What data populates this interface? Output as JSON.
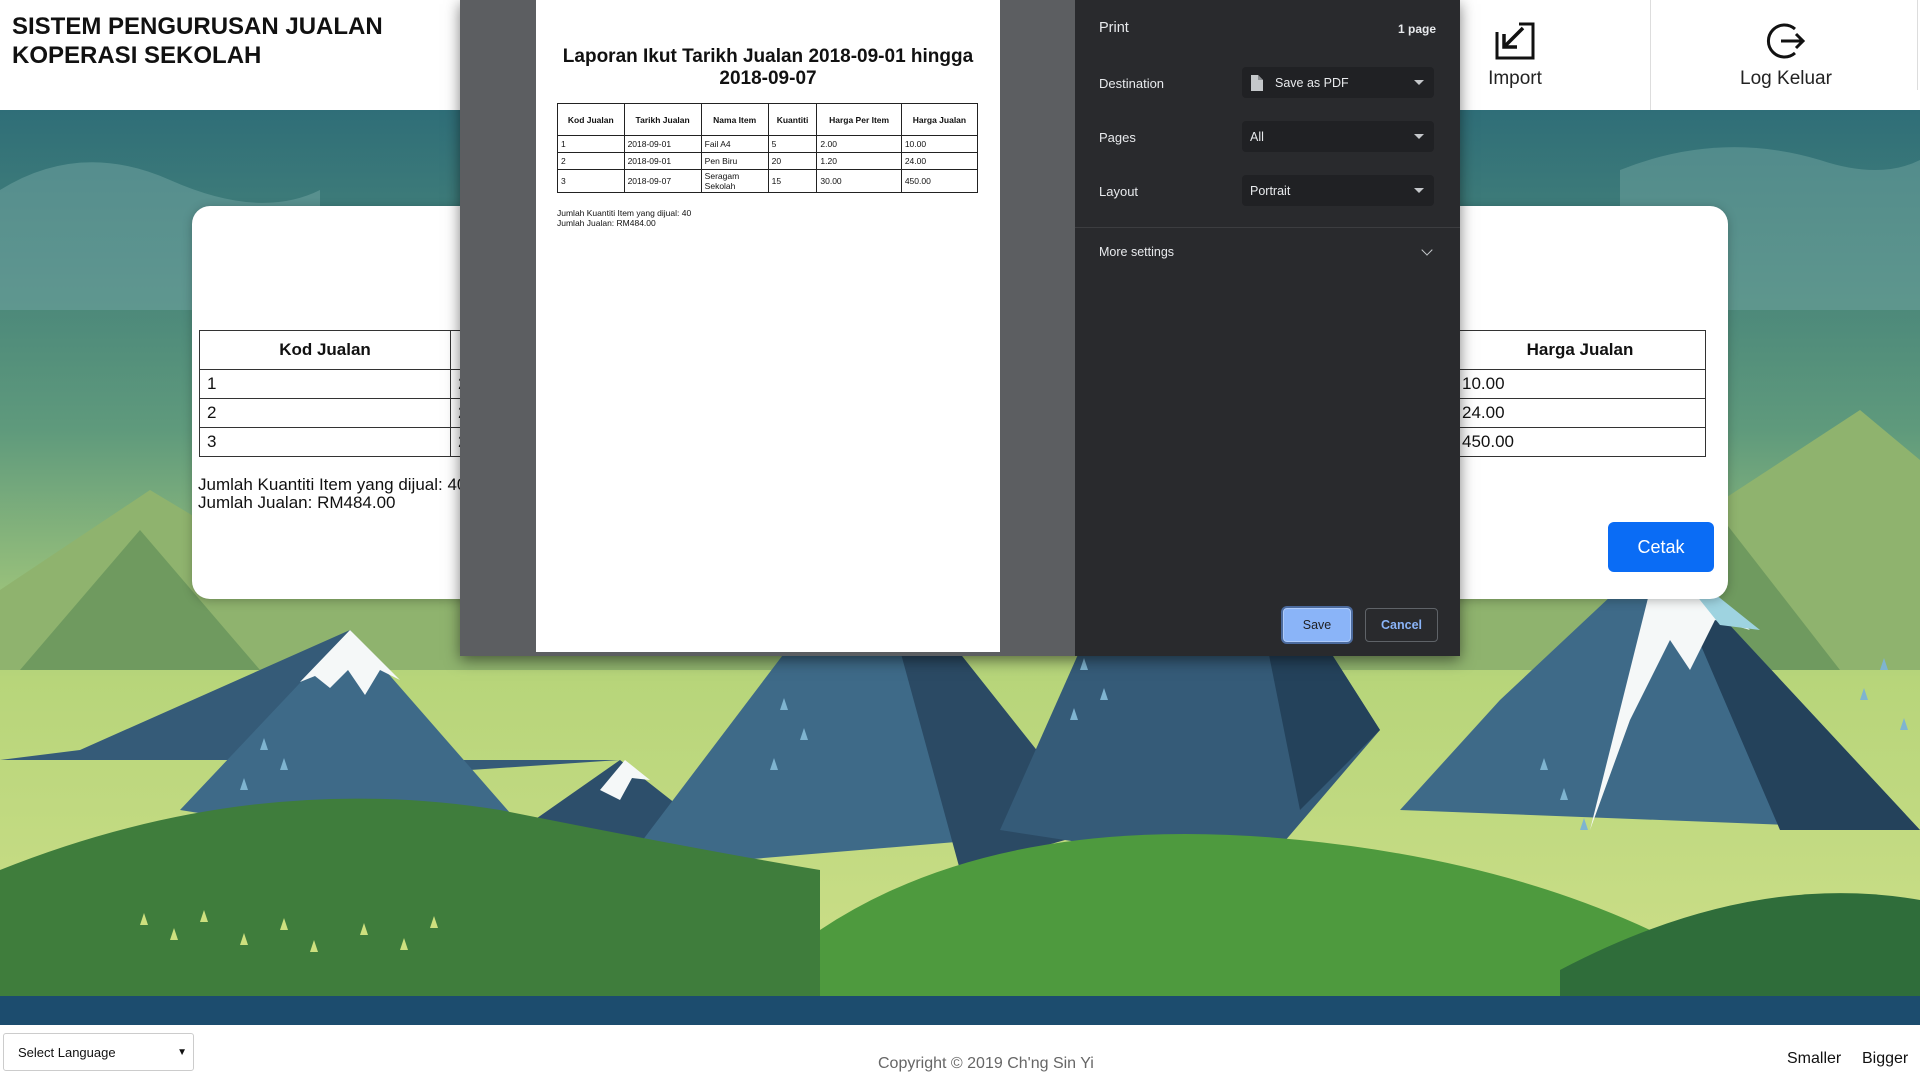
{
  "header": {
    "title": "SISTEM PENGURUSAN JUALAN KOPERASI SEKOLAH",
    "import_label": "Import",
    "logout_label": "Log Keluar"
  },
  "report": {
    "columns": [
      "Kod Jualan",
      "Tarikh Jualan",
      "Nama Item",
      "Kuantiti",
      "Harga Per Item",
      "Harga Jualan"
    ],
    "rows": [
      [
        "1",
        "2018-09-01",
        "Fail A4",
        "5",
        "2.00",
        "10.00"
      ],
      [
        "2",
        "2018-09-01",
        "Pen Biru",
        "20",
        "1.20",
        "24.00"
      ],
      [
        "3",
        "2018-09-07",
        "Seragam Sekolah",
        "15",
        "30.00",
        "450.00"
      ]
    ],
    "summary_qty": "Jumlah Kuantiti Item yang dijual: 40",
    "summary_total": "Jumlah Jualan: RM484.00",
    "print_button": "Cetak"
  },
  "print_preview": {
    "title": "Laporan Ikut Tarikh Jualan 2018-09-01 hingga 2018-09-07"
  },
  "print_settings": {
    "heading": "Print",
    "page_count": "1 page",
    "destination_label": "Destination",
    "destination_value": "Save as PDF",
    "pages_label": "Pages",
    "pages_value": "All",
    "layout_label": "Layout",
    "layout_value": "Portrait",
    "more_settings": "More settings",
    "save_button": "Save",
    "cancel_button": "Cancel"
  },
  "footer": {
    "language_select": "Select Language",
    "copyright": "Copyright © 2019 Ch'ng Sin Yi",
    "smaller": "Smaller",
    "bigger": "Bigger"
  },
  "colors": {
    "primary_button": "#0a6cf5",
    "dialog_background": "#292a2d",
    "dialog_accent": "#8ab4f8",
    "preview_background": "#5c5e61"
  }
}
